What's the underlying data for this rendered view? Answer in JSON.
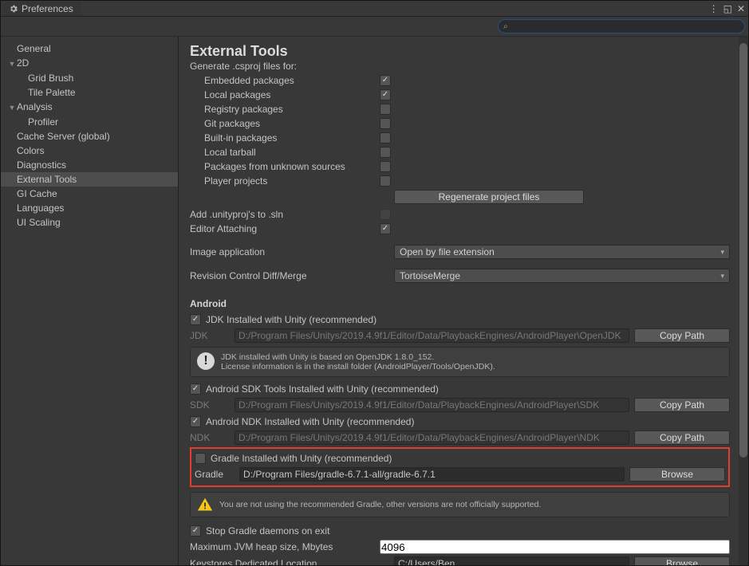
{
  "window": {
    "title": "Preferences"
  },
  "search": {
    "placeholder": ""
  },
  "sidebar": {
    "items": [
      {
        "label": "General",
        "indent": 0,
        "fold": ""
      },
      {
        "label": "2D",
        "indent": 0,
        "fold": "▼"
      },
      {
        "label": "Grid Brush",
        "indent": 1,
        "fold": ""
      },
      {
        "label": "Tile Palette",
        "indent": 1,
        "fold": ""
      },
      {
        "label": "Analysis",
        "indent": 0,
        "fold": "▼"
      },
      {
        "label": "Profiler",
        "indent": 1,
        "fold": ""
      },
      {
        "label": "Cache Server (global)",
        "indent": 0,
        "fold": ""
      },
      {
        "label": "Colors",
        "indent": 0,
        "fold": ""
      },
      {
        "label": "Diagnostics",
        "indent": 0,
        "fold": ""
      },
      {
        "label": "External Tools",
        "indent": 0,
        "fold": "",
        "selected": true
      },
      {
        "label": "GI Cache",
        "indent": 0,
        "fold": ""
      },
      {
        "label": "Languages",
        "indent": 0,
        "fold": ""
      },
      {
        "label": "UI Scaling",
        "indent": 0,
        "fold": ""
      }
    ]
  },
  "main": {
    "title": "External Tools",
    "csproj_header": "Generate .csproj files for:",
    "csproj": [
      {
        "label": "Embedded packages",
        "checked": true
      },
      {
        "label": "Local packages",
        "checked": true
      },
      {
        "label": "Registry packages",
        "checked": false
      },
      {
        "label": "Git packages",
        "checked": false
      },
      {
        "label": "Built-in packages",
        "checked": false
      },
      {
        "label": "Local tarball",
        "checked": false
      },
      {
        "label": "Packages from unknown sources",
        "checked": false
      },
      {
        "label": "Player projects",
        "checked": false
      }
    ],
    "regen_button": "Regenerate project files",
    "add_unityproj": {
      "label": "Add .unityproj's to .sln",
      "checked": false,
      "disabled": true
    },
    "editor_attaching": {
      "label": "Editor Attaching",
      "checked": true
    },
    "image_app": {
      "label": "Image application",
      "value": "Open by file extension"
    },
    "diff_merge": {
      "label": "Revision Control Diff/Merge",
      "value": "TortoiseMerge"
    },
    "android_header": "Android",
    "jdk": {
      "checkbox_label": "JDK Installed with Unity (recommended)",
      "checked": true,
      "field_label": "JDK",
      "path": "D:/Program Files/Unitys/2019.4.9f1/Editor/Data/PlaybackEngines/AndroidPlayer\\OpenJDK",
      "button": "Copy Path",
      "info_l1": "JDK installed with Unity is based on OpenJDK 1.8.0_152.",
      "info_l2": "License information is in the install folder (AndroidPlayer/Tools/OpenJDK)."
    },
    "sdk": {
      "checkbox_label": "Android SDK Tools Installed with Unity (recommended)",
      "checked": true,
      "field_label": "SDK",
      "path": "D:/Program Files/Unitys/2019.4.9f1/Editor/Data/PlaybackEngines/AndroidPlayer\\SDK",
      "button": "Copy Path"
    },
    "ndk": {
      "checkbox_label": "Android NDK Installed with Unity (recommended)",
      "checked": true,
      "field_label": "NDK",
      "path": "D:/Program Files/Unitys/2019.4.9f1/Editor/Data/PlaybackEngines/AndroidPlayer\\NDK",
      "button": "Copy Path"
    },
    "gradle": {
      "checkbox_label": "Gradle Installed with Unity (recommended)",
      "checked": false,
      "field_label": "Gradle",
      "path": "D:/Program Files/gradle-6.7.1-all/gradle-6.7.1",
      "button": "Browse",
      "warning": "You are not using the recommended Gradle, other versions are not officially supported."
    },
    "stop_daemons": {
      "label": "Stop Gradle daemons on exit",
      "checked": true
    },
    "jvm_heap": {
      "label": "Maximum JVM heap size, Mbytes",
      "value": "4096"
    },
    "keystore": {
      "label": "Keystores Dedicated Location",
      "value": "C:/Users/Ben",
      "button": "Browse"
    }
  }
}
